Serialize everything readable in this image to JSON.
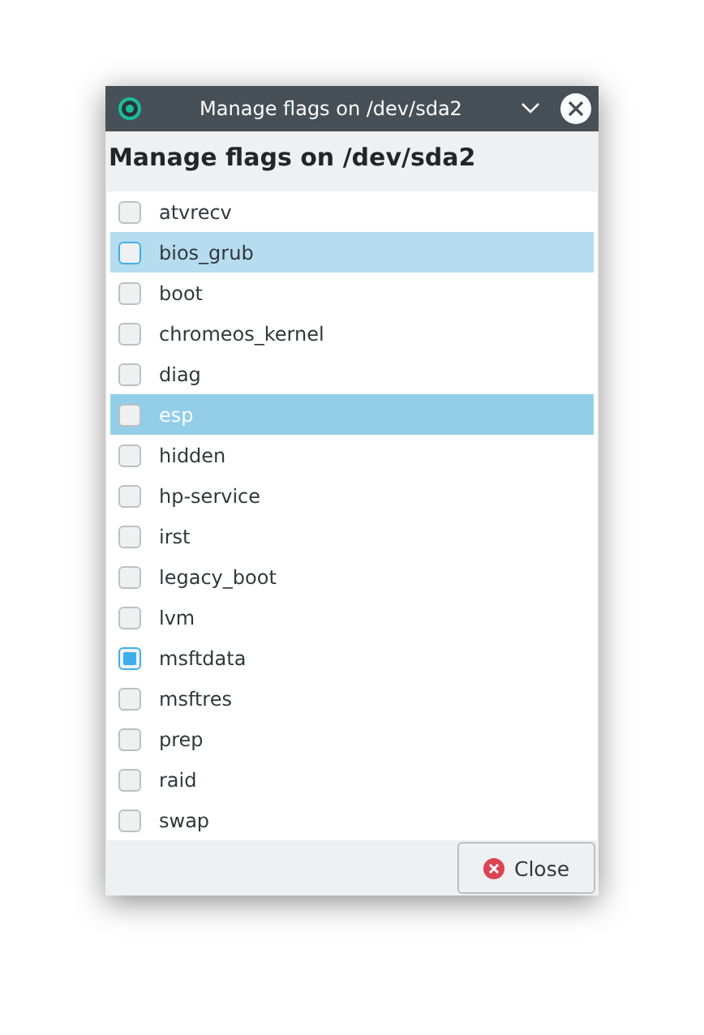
{
  "window": {
    "title": "Manage flags on /dev/sda2"
  },
  "heading": "Manage flags on /dev/sda2",
  "flags": [
    {
      "label": "atvrecv",
      "checked": false,
      "selected": false,
      "hovered": false
    },
    {
      "label": "bios_grub",
      "checked": false,
      "selected": false,
      "hovered": true
    },
    {
      "label": "boot",
      "checked": false,
      "selected": false,
      "hovered": false
    },
    {
      "label": "chromeos_kernel",
      "checked": false,
      "selected": false,
      "hovered": false
    },
    {
      "label": "diag",
      "checked": false,
      "selected": false,
      "hovered": false
    },
    {
      "label": "esp",
      "checked": false,
      "selected": true,
      "hovered": false
    },
    {
      "label": "hidden",
      "checked": false,
      "selected": false,
      "hovered": false
    },
    {
      "label": "hp-service",
      "checked": false,
      "selected": false,
      "hovered": false
    },
    {
      "label": "irst",
      "checked": false,
      "selected": false,
      "hovered": false
    },
    {
      "label": "legacy_boot",
      "checked": false,
      "selected": false,
      "hovered": false
    },
    {
      "label": "lvm",
      "checked": false,
      "selected": false,
      "hovered": false
    },
    {
      "label": "msftdata",
      "checked": true,
      "selected": false,
      "hovered": false
    },
    {
      "label": "msftres",
      "checked": false,
      "selected": false,
      "hovered": false
    },
    {
      "label": "prep",
      "checked": false,
      "selected": false,
      "hovered": false
    },
    {
      "label": "raid",
      "checked": false,
      "selected": false,
      "hovered": false
    },
    {
      "label": "swap",
      "checked": false,
      "selected": false,
      "hovered": false
    }
  ],
  "buttons": [
    {
      "label": "Close"
    }
  ]
}
